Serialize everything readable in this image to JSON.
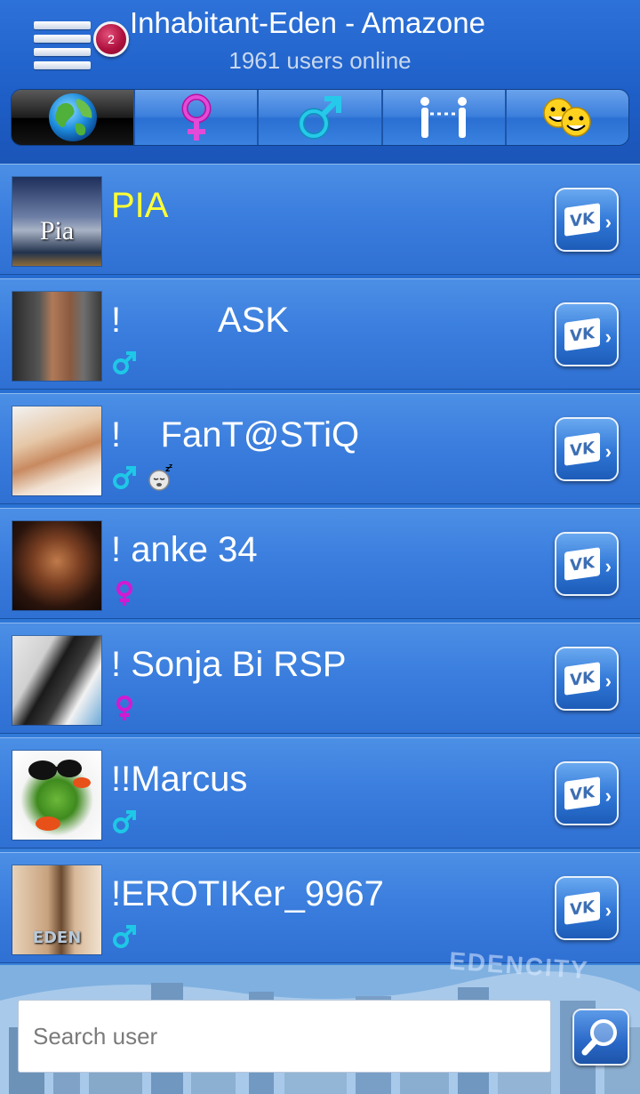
{
  "header": {
    "title": "Inhabitant-Eden - Amazone",
    "subtitle": "1961 users online",
    "notification_count": "2"
  },
  "tabs": [
    {
      "icon": "globe-icon",
      "active": true
    },
    {
      "icon": "female-symbol-icon",
      "active": false
    },
    {
      "icon": "male-symbol-icon",
      "active": false
    },
    {
      "icon": "couple-icon",
      "active": false
    },
    {
      "icon": "smileys-icon",
      "active": false
    }
  ],
  "users": [
    {
      "name": "PIA",
      "highlight": true,
      "gender": "none",
      "status": "none",
      "avatar_caption": "Pia"
    },
    {
      "name": "!          ASK",
      "gender": "male",
      "status": "none"
    },
    {
      "name": "!    FanT@STiQ",
      "gender": "male",
      "status": "sleeping"
    },
    {
      "name": "! anke 34",
      "gender": "female",
      "status": "none"
    },
    {
      "name": "! Sonja Bi RSP",
      "gender": "female",
      "status": "none"
    },
    {
      "name": "!!Marcus",
      "gender": "male",
      "status": "none"
    },
    {
      "name": "!EROTIKer_9967",
      "gender": "male",
      "status": "none",
      "avatar_caption": "EDEN"
    }
  ],
  "vk_label": "VK",
  "background_caption": "EDENCITY",
  "search": {
    "placeholder": "Search user",
    "value": ""
  },
  "colors": {
    "male": "#1ec8e6",
    "female": "#d21ad2",
    "highlight": "#ffff33",
    "accent": "#2e78d8"
  }
}
